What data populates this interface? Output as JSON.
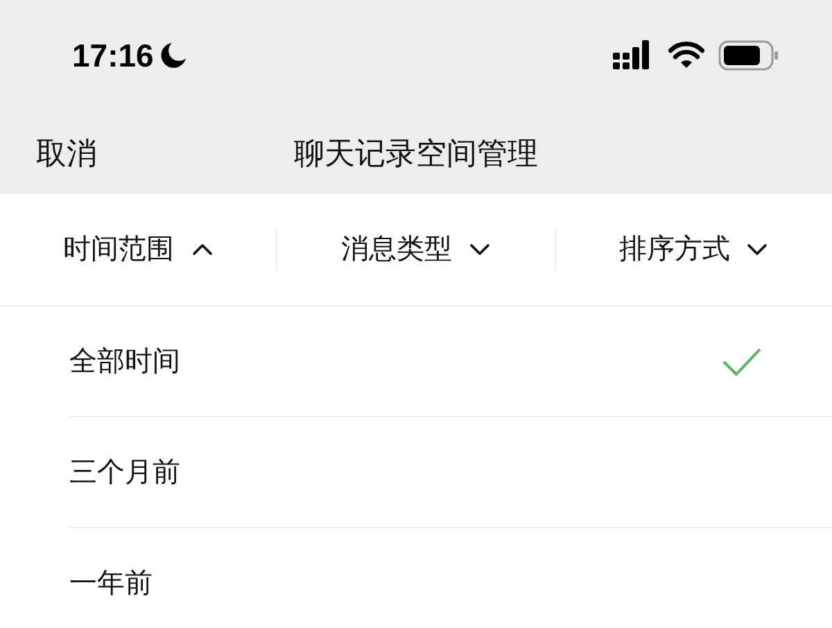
{
  "status_bar": {
    "time": "17:16",
    "focus_mode": true
  },
  "nav_bar": {
    "cancel": "取消",
    "title": "聊天记录空间管理"
  },
  "filters": [
    {
      "label": "时间范围",
      "expanded": true
    },
    {
      "label": "消息类型",
      "expanded": false
    },
    {
      "label": "排序方式",
      "expanded": false
    }
  ],
  "options": [
    {
      "label": "全部时间",
      "selected": true
    },
    {
      "label": "三个月前",
      "selected": false
    },
    {
      "label": "一年前",
      "selected": false
    }
  ]
}
